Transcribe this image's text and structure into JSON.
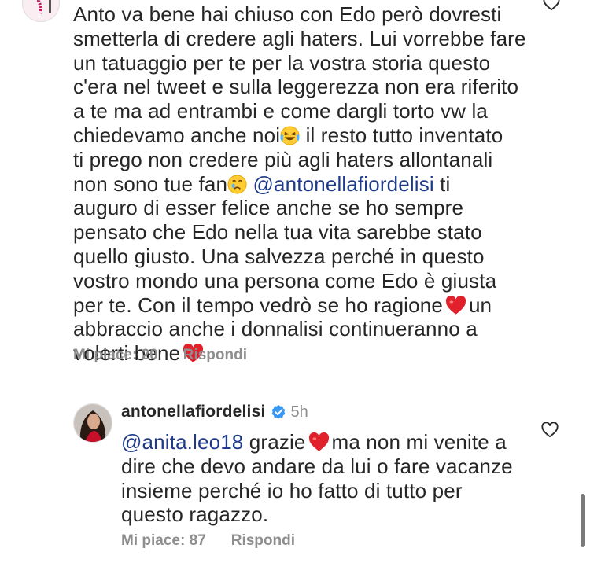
{
  "first_comment": {
    "lines": [
      "Anto va bene hai chiuso con Edo però dovresti",
      "smetterla di credere agli haters. Lui vorrebbe fare",
      "un tatuaggio per te per la vostra storia questo",
      "c'era nel tweet e sulla leggerezza non era riferito",
      "a te ma ad entrambi e come dargli torto vw la",
      "il resto tutto inventato",
      "ti prego non credere più agli haters allontanali",
      "ti",
      "auguro di esser felice anche se ho sempre",
      "pensato che Edo nella tua vita sarebbe stato",
      "quello giusto. Una salvezza perché in questo",
      "vostro mondo una persona come Edo è giusta",
      "per te. Con il tempo vedrò se ho ragione",
      "un",
      "abbraccio anche i donnalisi continueranno a",
      "volerti bene"
    ],
    "line6_start": "chiedevamo anche noi",
    "line8_start": "non sono tue fan",
    "mention": "@antonellafiordelisi",
    "likes_label": "Mi piace: 20",
    "reply_label": "Rispondi"
  },
  "reply_comment": {
    "username": "antonellafiordelisi",
    "timestamp": "5h",
    "mention": "@anita.leo18",
    "line1_mid": "grazie",
    "line1_end": "ma non mi venite a",
    "lines": [
      "dire che devo andare da lui o fare vacanze",
      "insieme perché io ho fatto di tutto per",
      "questo ragazzo."
    ],
    "likes_label": "Mi piace: 87",
    "reply_label": "Rispondi"
  },
  "colors": {
    "text": "#262626",
    "meta": "#8e8e8e",
    "mention": "#1e3a8a",
    "heart": "#e0202a",
    "verified": "#3897f0"
  },
  "icons": [
    "heart-outline-icon",
    "heart-emoji-icon",
    "laughing-emoji-icon",
    "crying-emoji-icon",
    "verified-badge-icon"
  ]
}
